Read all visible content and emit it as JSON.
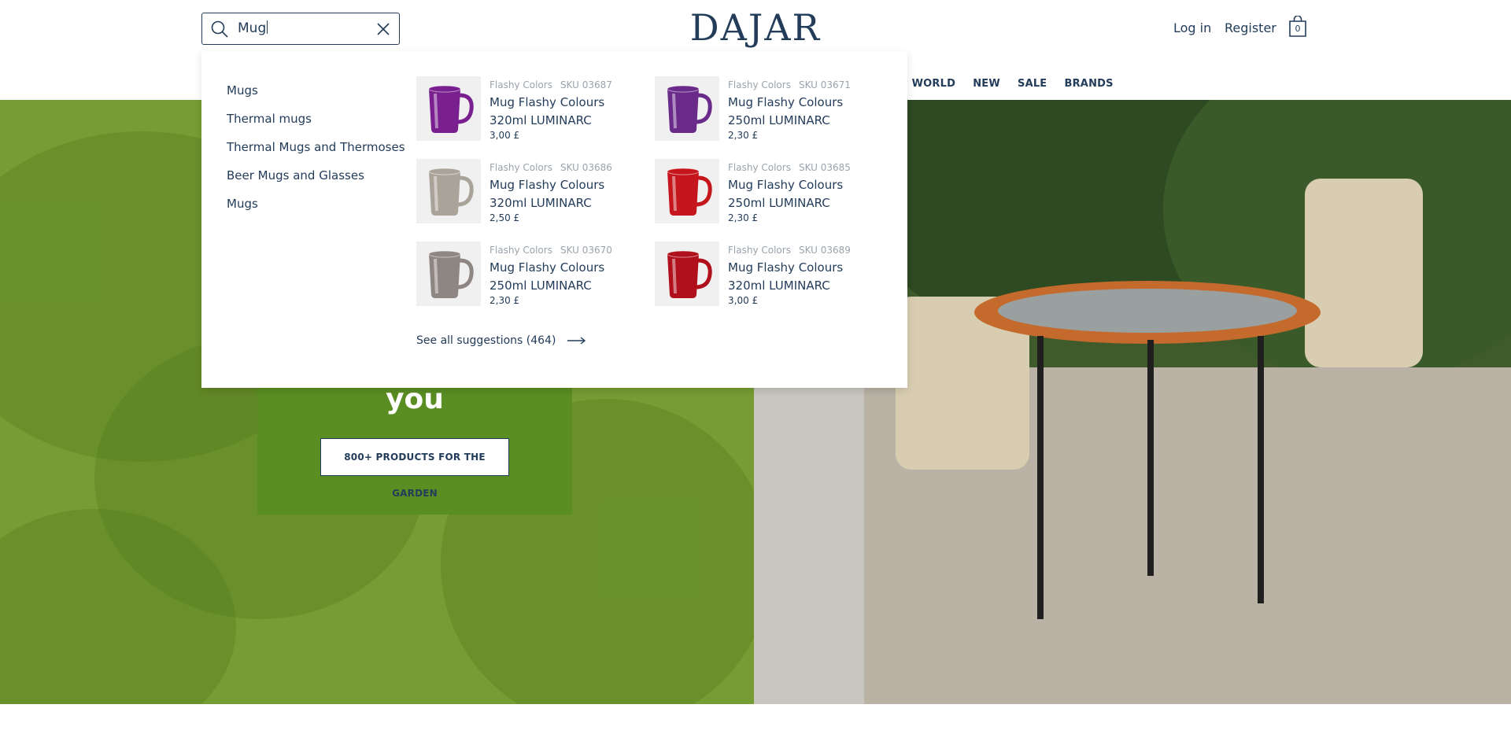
{
  "header": {
    "logo": "DAJAR",
    "search": {
      "value": "Mug"
    },
    "login": "Log in",
    "register": "Register",
    "cart_count": "0"
  },
  "nav": {
    "items": [
      "EN'S WORLD",
      "NEW",
      "SALE",
      "BRANDS"
    ]
  },
  "hero": {
    "word": "you",
    "button": "800+ PRODUCTS FOR THE GARDEN"
  },
  "dropdown": {
    "suggestions": [
      "Mugs",
      "Thermal mugs",
      "Thermal Mugs and Thermoses",
      "Beer Mugs and Glasses",
      "Mugs"
    ],
    "products": [
      {
        "brand": "Flashy Colors",
        "sku": "SKU 03687",
        "name": "Mug Flashy Colours 320ml LUMINARC",
        "price": "3,00 £",
        "color": "#7a1f8f"
      },
      {
        "brand": "Flashy Colors",
        "sku": "SKU 03671",
        "name": "Mug Flashy Colours 250ml LUMINARC",
        "price": "2,30 £",
        "color": "#6a2a8a"
      },
      {
        "brand": "Flashy Colors",
        "sku": "SKU 03686",
        "name": "Mug Flashy Colours 320ml LUMINARC",
        "price": "2,50 £",
        "color": "#a9a39a"
      },
      {
        "brand": "Flashy Colors",
        "sku": "SKU 03685",
        "name": "Mug Flashy Colours 250ml LUMINARC",
        "price": "2,30 £",
        "color": "#c4161c"
      },
      {
        "brand": "Flashy Colors",
        "sku": "SKU 03670",
        "name": "Mug Flashy Colours 250ml LUMINARC",
        "price": "2,30 £",
        "color": "#8e8682"
      },
      {
        "brand": "Flashy Colors",
        "sku": "SKU 03689",
        "name": "Mug Flashy Colours 320ml LUMINARC",
        "price": "3,00 £",
        "color": "#b0101c"
      }
    ],
    "see_all": "See all suggestions (464)"
  },
  "colors": {
    "brand_navy": "#233c5a",
    "hero_green": "#5a8e22"
  }
}
